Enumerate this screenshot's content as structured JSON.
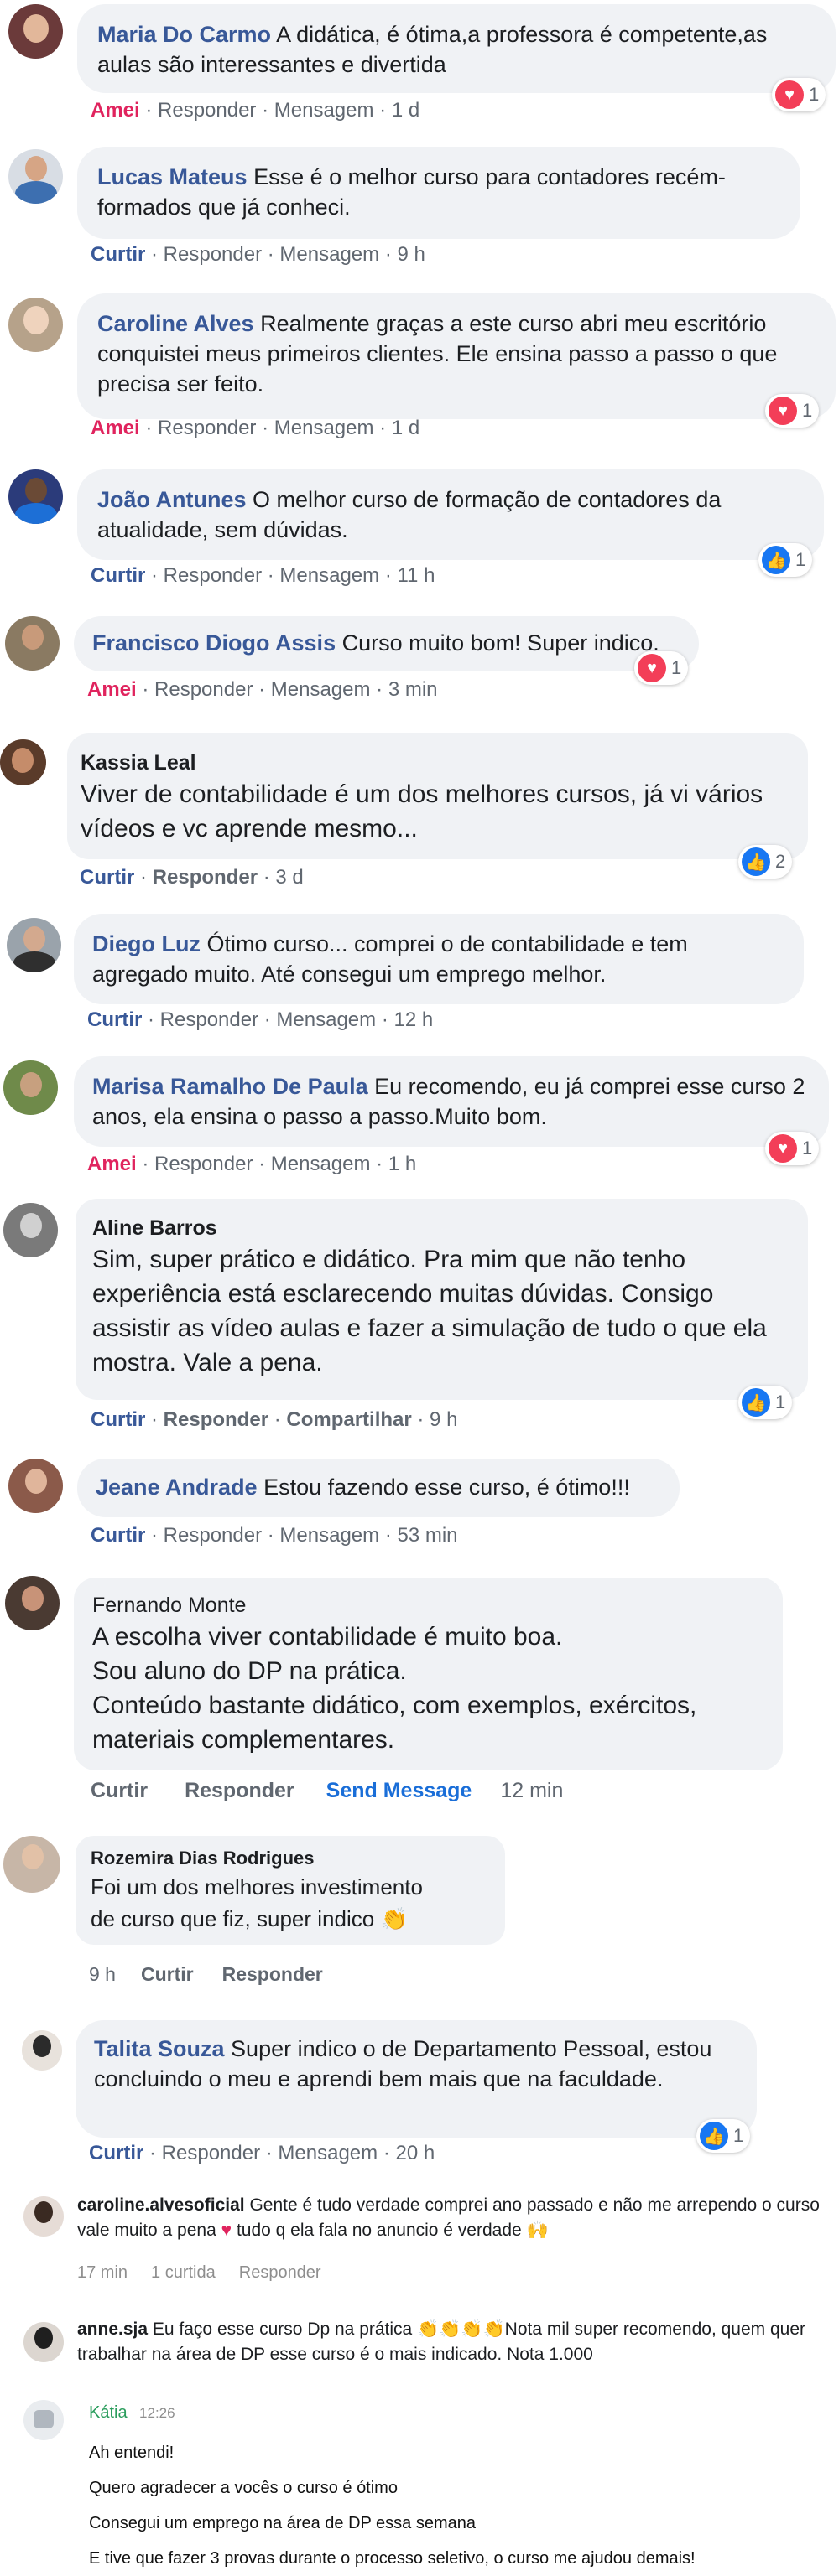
{
  "comments": [
    {
      "name": "Maria Do Carmo",
      "text": "A didática, é ótima,a professora é competente,as aulas são interessantes e divertida",
      "a1": "Amei",
      "a2": "Responder",
      "a3": "Mensagem",
      "time": "1 d",
      "count": "1"
    },
    {
      "name": "Lucas Mateus",
      "text": "Esse é o melhor curso para contadores recém-formados que já conheci.",
      "a1": "Curtir",
      "a2": "Responder",
      "a3": "Mensagem",
      "time": "9 h"
    },
    {
      "name": "Caroline Alves",
      "text": "Realmente graças a este curso abri meu escritório conquistei meus primeiros clientes. Ele ensina passo a passo o que precisa ser feito.",
      "a1": "Amei",
      "a2": "Responder",
      "a3": "Mensagem",
      "time": "1 d",
      "count": "1"
    },
    {
      "name": "João Antunes",
      "text": "O melhor curso de formação de contadores da atualidade, sem dúvidas.",
      "a1": "Curtir",
      "a2": "Responder",
      "a3": "Mensagem",
      "time": "11 h",
      "count": "1"
    },
    {
      "name": "Francisco Diogo Assis",
      "text": "Curso muito bom! Super indico.",
      "a1": "Amei",
      "a2": "Responder",
      "a3": "Mensagem",
      "time": "3 min",
      "count": "1"
    },
    {
      "name": "Kassia Leal",
      "text": "Viver de contabilidade é um dos melhores cursos, já vi vários vídeos e vc aprende mesmo...",
      "a1": "Curtir",
      "a2": "Responder",
      "time": "3 d",
      "count": "2"
    },
    {
      "name": "Diego Luz",
      "text": "Ótimo curso... comprei o de contabilidade e tem agregado muito. Até consegui um emprego melhor.",
      "a1": "Curtir",
      "a2": "Responder",
      "a3": "Mensagem",
      "time": "12 h"
    },
    {
      "name": "Marisa Ramalho De Paula",
      "text": "Eu recomendo, eu já comprei esse curso 2 anos, ela ensina o passo a passo.Muito bom.",
      "a1": "Amei",
      "a2": "Responder",
      "a3": "Mensagem",
      "time": "1 h",
      "count": "1"
    },
    {
      "name": "Aline Barros",
      "text": "Sim, super prático e didático. Pra mim que não tenho experiência está esclarecendo muitas dúvidas. Consigo assistir as vídeo aulas e fazer a simulação de tudo o que ela mostra. Vale a pena.",
      "a1": "Curtir",
      "a2": "Responder",
      "a3": "Compartilhar",
      "time": "9 h",
      "count": "1"
    },
    {
      "name": "Jeane Andrade",
      "text": "Estou fazendo esse curso, é ótimo!!!",
      "a1": "Curtir",
      "a2": "Responder",
      "a3": "Mensagem",
      "time": "53 min"
    },
    {
      "name": "Fernando Monte",
      "lines": [
        "A escolha viver contabilidade é muito boa.",
        "Sou aluno do DP na prática.",
        "Conteúdo bastante didático, com exemplos, exércitos,",
        "materiais complementares."
      ],
      "a1": "Curtir",
      "a2": "Responder",
      "a3": "Send Message",
      "time": "12 min"
    },
    {
      "name": "Rozemira Dias Rodrigues",
      "lines": [
        "Foi um dos melhores investimento",
        "de curso que fiz, super indico"
      ],
      "time": "9 h",
      "a1": "Curtir",
      "a2": "Responder"
    },
    {
      "name": "Talita Souza",
      "text": "Super indico o de Departamento Pessoal, estou concluindo o meu e aprendi bem mais que na faculdade.",
      "a1": "Curtir",
      "a2": "Responder",
      "a3": "Mensagem",
      "time": "20 h",
      "count": "1"
    }
  ],
  "instagram": [
    {
      "name": "caroline.alvesoficial",
      "text": "Gente é tudo verdade comprei ano passado e não me arrependo o curso vale muito a pena",
      "text2": "tudo q ela fala no anuncio é verdade",
      "time": "17 min",
      "likes": "1 curtida",
      "reply": "Responder"
    },
    {
      "name": "anne.sja",
      "text": "Eu faço esse curso Dp na prática",
      "text2": "Nota mil super recomendo, quem quer trabalhar na área de DP esse curso é o mais indicado. Nota 1.000"
    }
  ],
  "chat": {
    "name": "Kátia",
    "time": "12:26",
    "lines": [
      "Ah entendi!",
      "Quero agradecer a vocês o curso é ótimo",
      "Consegui um emprego na área de DP essa semana",
      "E tive que fazer 3 provas durante o processo seletivo, o curso me ajudou demais!"
    ]
  },
  "colors": {
    "link": "#385898",
    "love": "#e0245e",
    "bubble": "#f0f2f5",
    "heart": "#f33e58",
    "thumb": "#1877f2"
  }
}
